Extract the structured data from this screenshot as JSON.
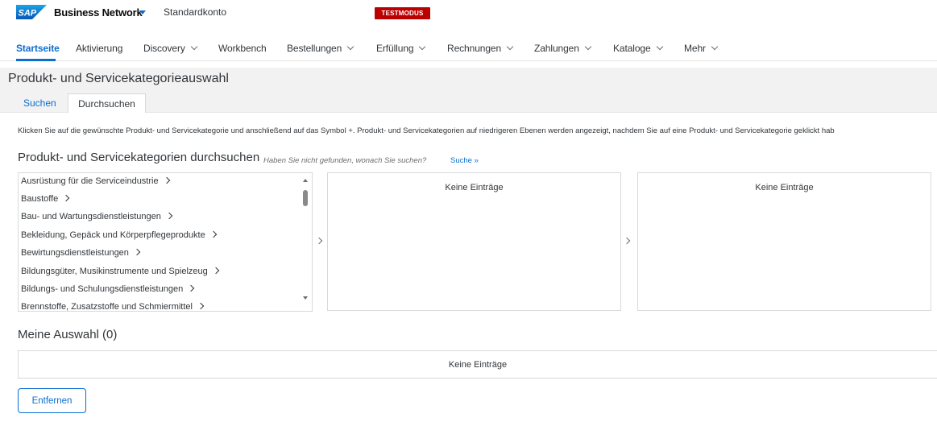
{
  "shell": {
    "logo_text": "SAP",
    "app_title": "Business Network",
    "account": "Standardkonto",
    "mode_badge": "TESTMODUS"
  },
  "nav": {
    "items": [
      {
        "label": "Startseite",
        "active": true
      },
      {
        "label": "Aktivierung"
      },
      {
        "label": "Discovery",
        "dropdown": true
      },
      {
        "label": "Workbench"
      },
      {
        "label": "Bestellungen",
        "dropdown": true
      },
      {
        "label": "Erfüllung",
        "dropdown": true
      },
      {
        "label": "Rechnungen",
        "dropdown": true
      },
      {
        "label": "Zahlungen",
        "dropdown": true
      },
      {
        "label": "Kataloge",
        "dropdown": true
      },
      {
        "label": "Mehr",
        "dropdown": true
      }
    ]
  },
  "page": {
    "title": "Produkt- und Servicekategorieauswahl",
    "tabs": [
      {
        "label": "Suchen"
      },
      {
        "label": "Durchsuchen",
        "selected": true
      }
    ],
    "instruction": "Klicken Sie auf die gewünschte Produkt- und Servicekategorie und anschließend auf das Symbol +. Produkt- und Servicekategorien auf niedrigeren Ebenen werden angezeigt, nachdem Sie auf eine Produkt- und Servicekategorie geklickt hab"
  },
  "browse": {
    "title": "Produkt- und Servicekategorien durchsuchen",
    "hint": "Haben Sie nicht gefunden, wonach Sie suchen?",
    "search_link": "Suche »",
    "categories": [
      "Ausrüstung für die Serviceindustrie",
      "Baustoffe",
      "Bau- und Wartungsdienstleistungen",
      "Bekleidung, Gepäck und Körperpflegeprodukte",
      "Bewirtungsdienstleistungen",
      "Bildungsgüter, Musikinstrumente und Spielzeug",
      "Bildungs- und Schulungsdienstleistungen",
      "Brennstoffe, Zusatzstoffe und Schmiermittel"
    ],
    "panel2_empty": "Keine Einträge",
    "panel3_empty": "Keine Einträge"
  },
  "selection": {
    "title": "Meine Auswahl (0)",
    "empty": "Keine Einträge",
    "remove_button": "Entfernen"
  },
  "colors": {
    "accent": "#0a6ed1",
    "badge": "#bb0000",
    "title_bar_bg": "#f2f2f2"
  }
}
